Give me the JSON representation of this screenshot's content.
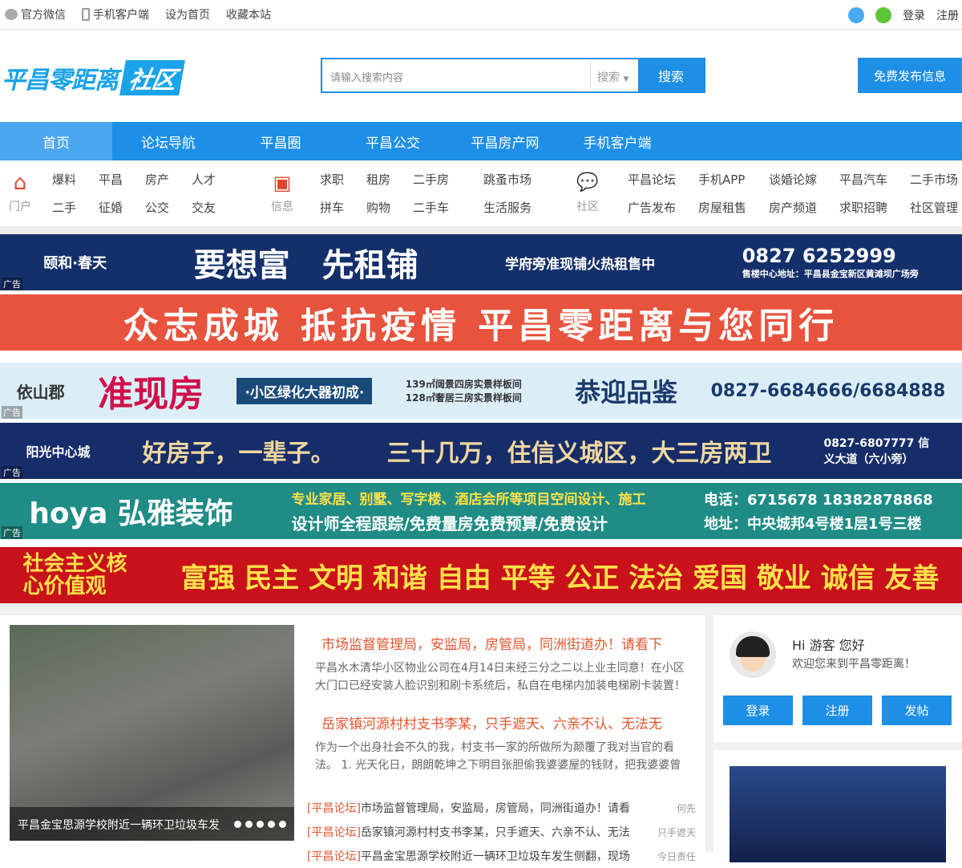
{
  "topbar": {
    "links": [
      "官方微信",
      "手机客户端",
      "设为首页",
      "收藏本站"
    ],
    "login": "登录",
    "register": "注册"
  },
  "header": {
    "logo_main": "平昌零距离",
    "logo_box": "社区",
    "search_placeholder": "请输入搜索内容",
    "search_select": "搜索",
    "search_button": "搜索",
    "publish_button": "免费发布信息"
  },
  "nav": [
    "首页",
    "论坛导航",
    "平昌圈",
    "平昌公交",
    "平昌房产网",
    "手机客户端"
  ],
  "categories": [
    {
      "label": "门户",
      "links": [
        "爆料",
        "平昌",
        "房产",
        "人才",
        "二手",
        "征婚",
        "公交",
        "交友"
      ]
    },
    {
      "label": "信息",
      "links": [
        "求职",
        "租房",
        "二手房",
        "跳蚤市场",
        "拼车",
        "购物",
        "二手车",
        "生活服务"
      ]
    },
    {
      "label": "社区",
      "links": [
        "平昌论坛",
        "手机APP",
        "谈婚论嫁",
        "平昌汽车",
        "二手市场",
        "广告发布",
        "房屋租售",
        "房产频道",
        "求职招聘",
        "社区管理"
      ]
    }
  ],
  "ad_label": "广告",
  "banners": [
    {
      "parts": [
        "颐和·春天",
        "要想富　先租铺",
        "学府旁准现铺火热租售中",
        "0827 6252999"
      ],
      "sub": "售楼中心地址：平昌县金宝新区黄滩坝广场旁"
    },
    {
      "parts": [
        "众志成城 抵抗疫情 平昌零距离与您同行"
      ]
    },
    {
      "parts": [
        "依山郡",
        "准现房",
        "·小区绿化大器初成·",
        "139㎡阔景四房实景样板间 128㎡奢居三房实景样板间",
        "恭迎品鉴",
        "0827-6684666/6684888"
      ]
    },
    {
      "parts": [
        "阳光中心城",
        "好房子，一辈子。",
        "三十几万，住信义城区，大三房两卫",
        "0827-6807777 信义大道（六小旁）"
      ]
    },
    {
      "parts": [
        "hoya 弘雅装饰",
        "专业家居、别墅、写字楼、酒店会所等项目空间设计、施工",
        "设计师全程跟踪/免费量房免费预算/免费设计",
        "电话：6715678 18382878868",
        "地址：中央城邦4号楼1层1号三楼"
      ]
    },
    {
      "parts": [
        "社会主义核心价值观",
        "富强 民主 文明 和谐 自由 平等 公正 法治 爱国 敬业 诚信 友善"
      ]
    }
  ],
  "slider": {
    "caption": "平昌金宝思源学校附近一辆环卫垃圾车发"
  },
  "news": [
    {
      "title": "市场监督管理局，安监局，房管局，同洲街道办！请看下",
      "summary": "平昌水木清华小区物业公司在4月14日未经三分之二以上业主同意！在小区大门口已经安装人脸识别和刷卡系统后，私自在电梯内加装电梯刷卡装置！"
    },
    {
      "title": "岳家镇河源村村支书李某，只手遮天、六亲不认、无法无",
      "summary": "作为一个出身社会不久的我，村支书一家的所做所为颠覆了我对当官的看法。 1. 光天化日，朗朗乾坤之下明目张胆偷我婆婆屋的钱财，把我婆婆曾"
    }
  ],
  "list": [
    {
      "tag": "[平昌论坛]",
      "title": "市场监督管理局，安监局，房管局，同洲街道办！请看",
      "author": "何先"
    },
    {
      "tag": "[平昌论坛]",
      "title": "岳家镇河源村村支书李某，只手遮天、六亲不认、无法",
      "author": "只手遮天"
    },
    {
      "tag": "[平昌论坛]",
      "title": "平昌金宝思源学校附近一辆环卫垃圾车发生侧翻，现场",
      "author": "今日责任"
    }
  ],
  "user": {
    "greeting": "Hi 游客 您好",
    "welcome": "欢迎您来到平昌零距离！",
    "login": "登录",
    "register": "注册",
    "post": "发帖"
  }
}
